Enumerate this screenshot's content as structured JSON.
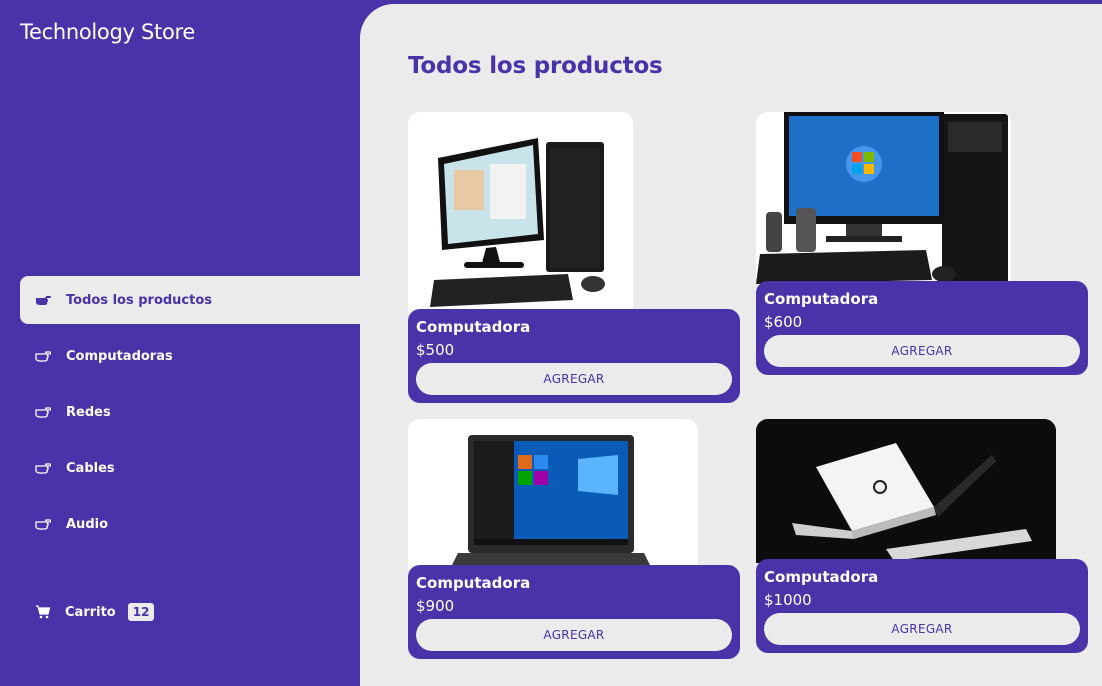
{
  "app": {
    "brand": "Technology Store"
  },
  "nav": [
    {
      "label": "Todos los productos",
      "active": true
    },
    {
      "label": "Computadoras"
    },
    {
      "label": "Redes"
    },
    {
      "label": "Cables"
    },
    {
      "label": "Audio"
    }
  ],
  "cart": {
    "label": "Carrito",
    "count": "12"
  },
  "page": {
    "title": "Todos los productos"
  },
  "products": [
    {
      "name": "Computadora",
      "price": "$500",
      "button": "AGREGAR",
      "image": "desktop-monitor-tower"
    },
    {
      "name": "Computadora",
      "price": "$600",
      "button": "AGREGAR",
      "image": "desktop-windows7-tower-speakers"
    },
    {
      "name": "Computadora",
      "price": "$900",
      "button": "AGREGAR",
      "image": "laptop-windows10"
    },
    {
      "name": "Computadora",
      "price": "$1000",
      "button": "AGREGAR",
      "image": "two-laptops-dark"
    }
  ],
  "colors": {
    "primary": "#4a32a8",
    "surface": "#ebebeb"
  }
}
